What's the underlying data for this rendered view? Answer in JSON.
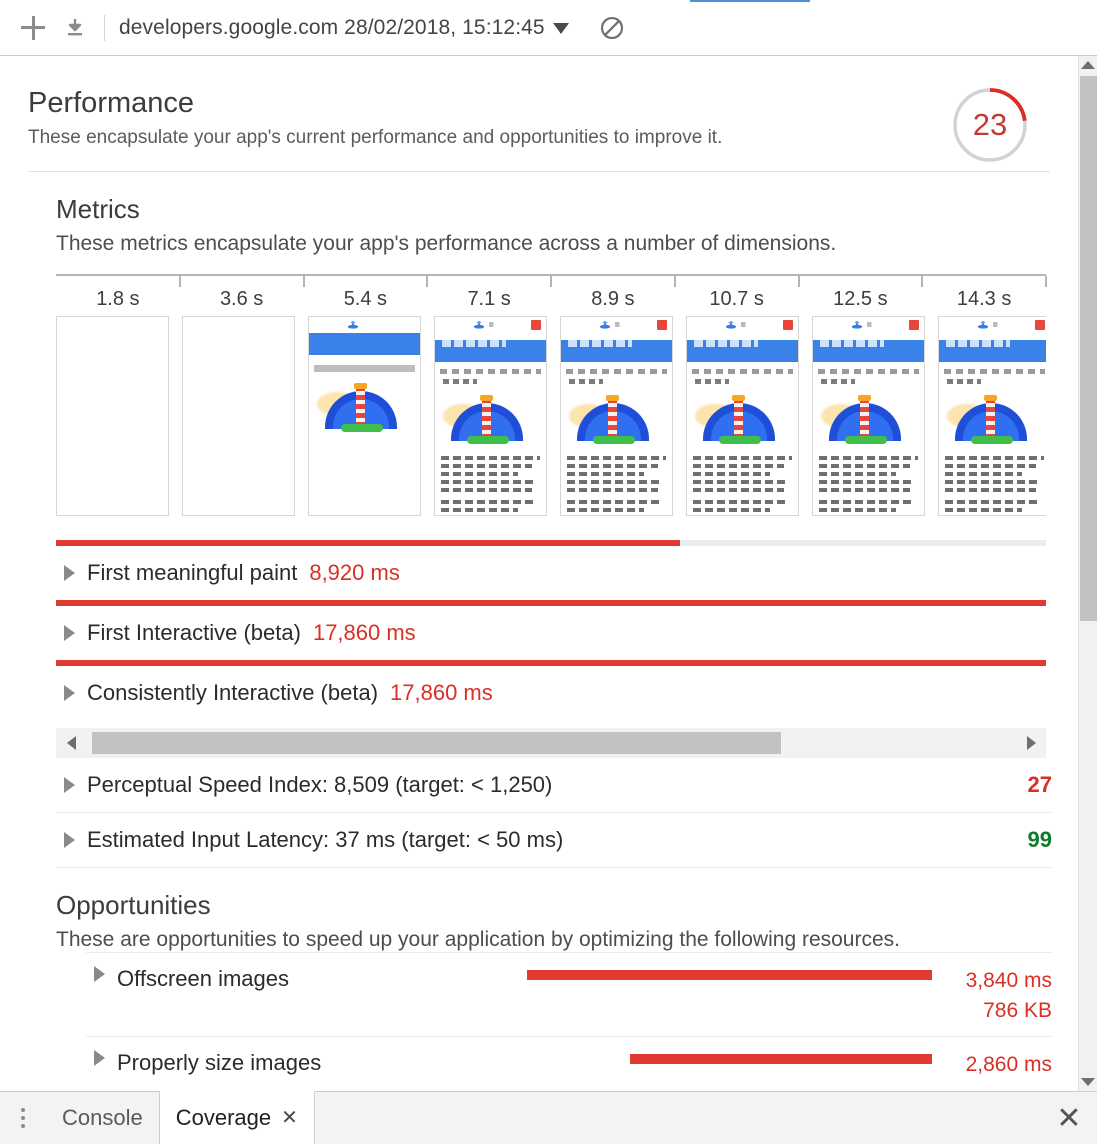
{
  "toolbar": {
    "new_audit_icon": "plus-icon",
    "export_icon": "download-icon",
    "report_label": "developers.google.com 28/02/2018, 15:12:45",
    "dropdown_icon": "chevron-down-icon",
    "clear_icon": "no-entry-icon"
  },
  "report": {
    "title": "Performance",
    "description": "These encapsulate your app's current performance and opportunities to improve it.",
    "score": "23",
    "score_color": "#c33a33",
    "score_percent": 23
  },
  "metrics": {
    "title": "Metrics",
    "description": "These metrics encapsulate your app's performance across a number of dimensions.",
    "timeline_ticks": [
      "1.8 s",
      "3.6 s",
      "5.4 s",
      "7.1 s",
      "8.9 s",
      "10.7 s",
      "12.5 s",
      "14.3 s"
    ],
    "filmstrip_frames": [
      {
        "stage": "blank"
      },
      {
        "stage": "blank"
      },
      {
        "stage": "nav-gray"
      },
      {
        "stage": "full"
      },
      {
        "stage": "full"
      },
      {
        "stage": "full"
      },
      {
        "stage": "full"
      },
      {
        "stage": "full"
      }
    ],
    "rows": [
      {
        "label": "First meaningful paint",
        "value": "8,920 ms",
        "bar_percent": 63
      },
      {
        "label": "First Interactive (beta)",
        "value": "17,860 ms",
        "bar_percent": 100
      },
      {
        "label": "Consistently Interactive (beta)",
        "value": "17,860 ms",
        "bar_percent": 100
      }
    ],
    "scroll_thumb_percent": 75,
    "plain_rows": [
      {
        "label": "Perceptual Speed Index: 8,509 (target: < 1,250)",
        "score": "27",
        "status": "bad"
      },
      {
        "label": "Estimated Input Latency: 37 ms (target: < 50 ms)",
        "score": "99",
        "status": "good"
      }
    ]
  },
  "opportunities": {
    "title": "Opportunities",
    "description": "These are opportunities to speed up your application by optimizing the following resources.",
    "rows": [
      {
        "label": "Offscreen images",
        "time": "3,840 ms",
        "size": "786 KB",
        "bar_start": 5,
        "bar_end": 100
      },
      {
        "label": "Properly size images",
        "time": "2,860 ms",
        "size": "",
        "bar_start": 29,
        "bar_end": 100
      }
    ]
  },
  "drawer": {
    "menu_icon": "kebab-menu-icon",
    "tabs": [
      {
        "label": "Console",
        "active": false
      },
      {
        "label": "Coverage",
        "active": true,
        "close_icon": "close-icon"
      }
    ],
    "close_icon": "close-icon"
  },
  "colors": {
    "red": "#e03a33",
    "red_text": "#d93025",
    "green": "#0b7d28",
    "blue_accent": "#4a90d9"
  }
}
